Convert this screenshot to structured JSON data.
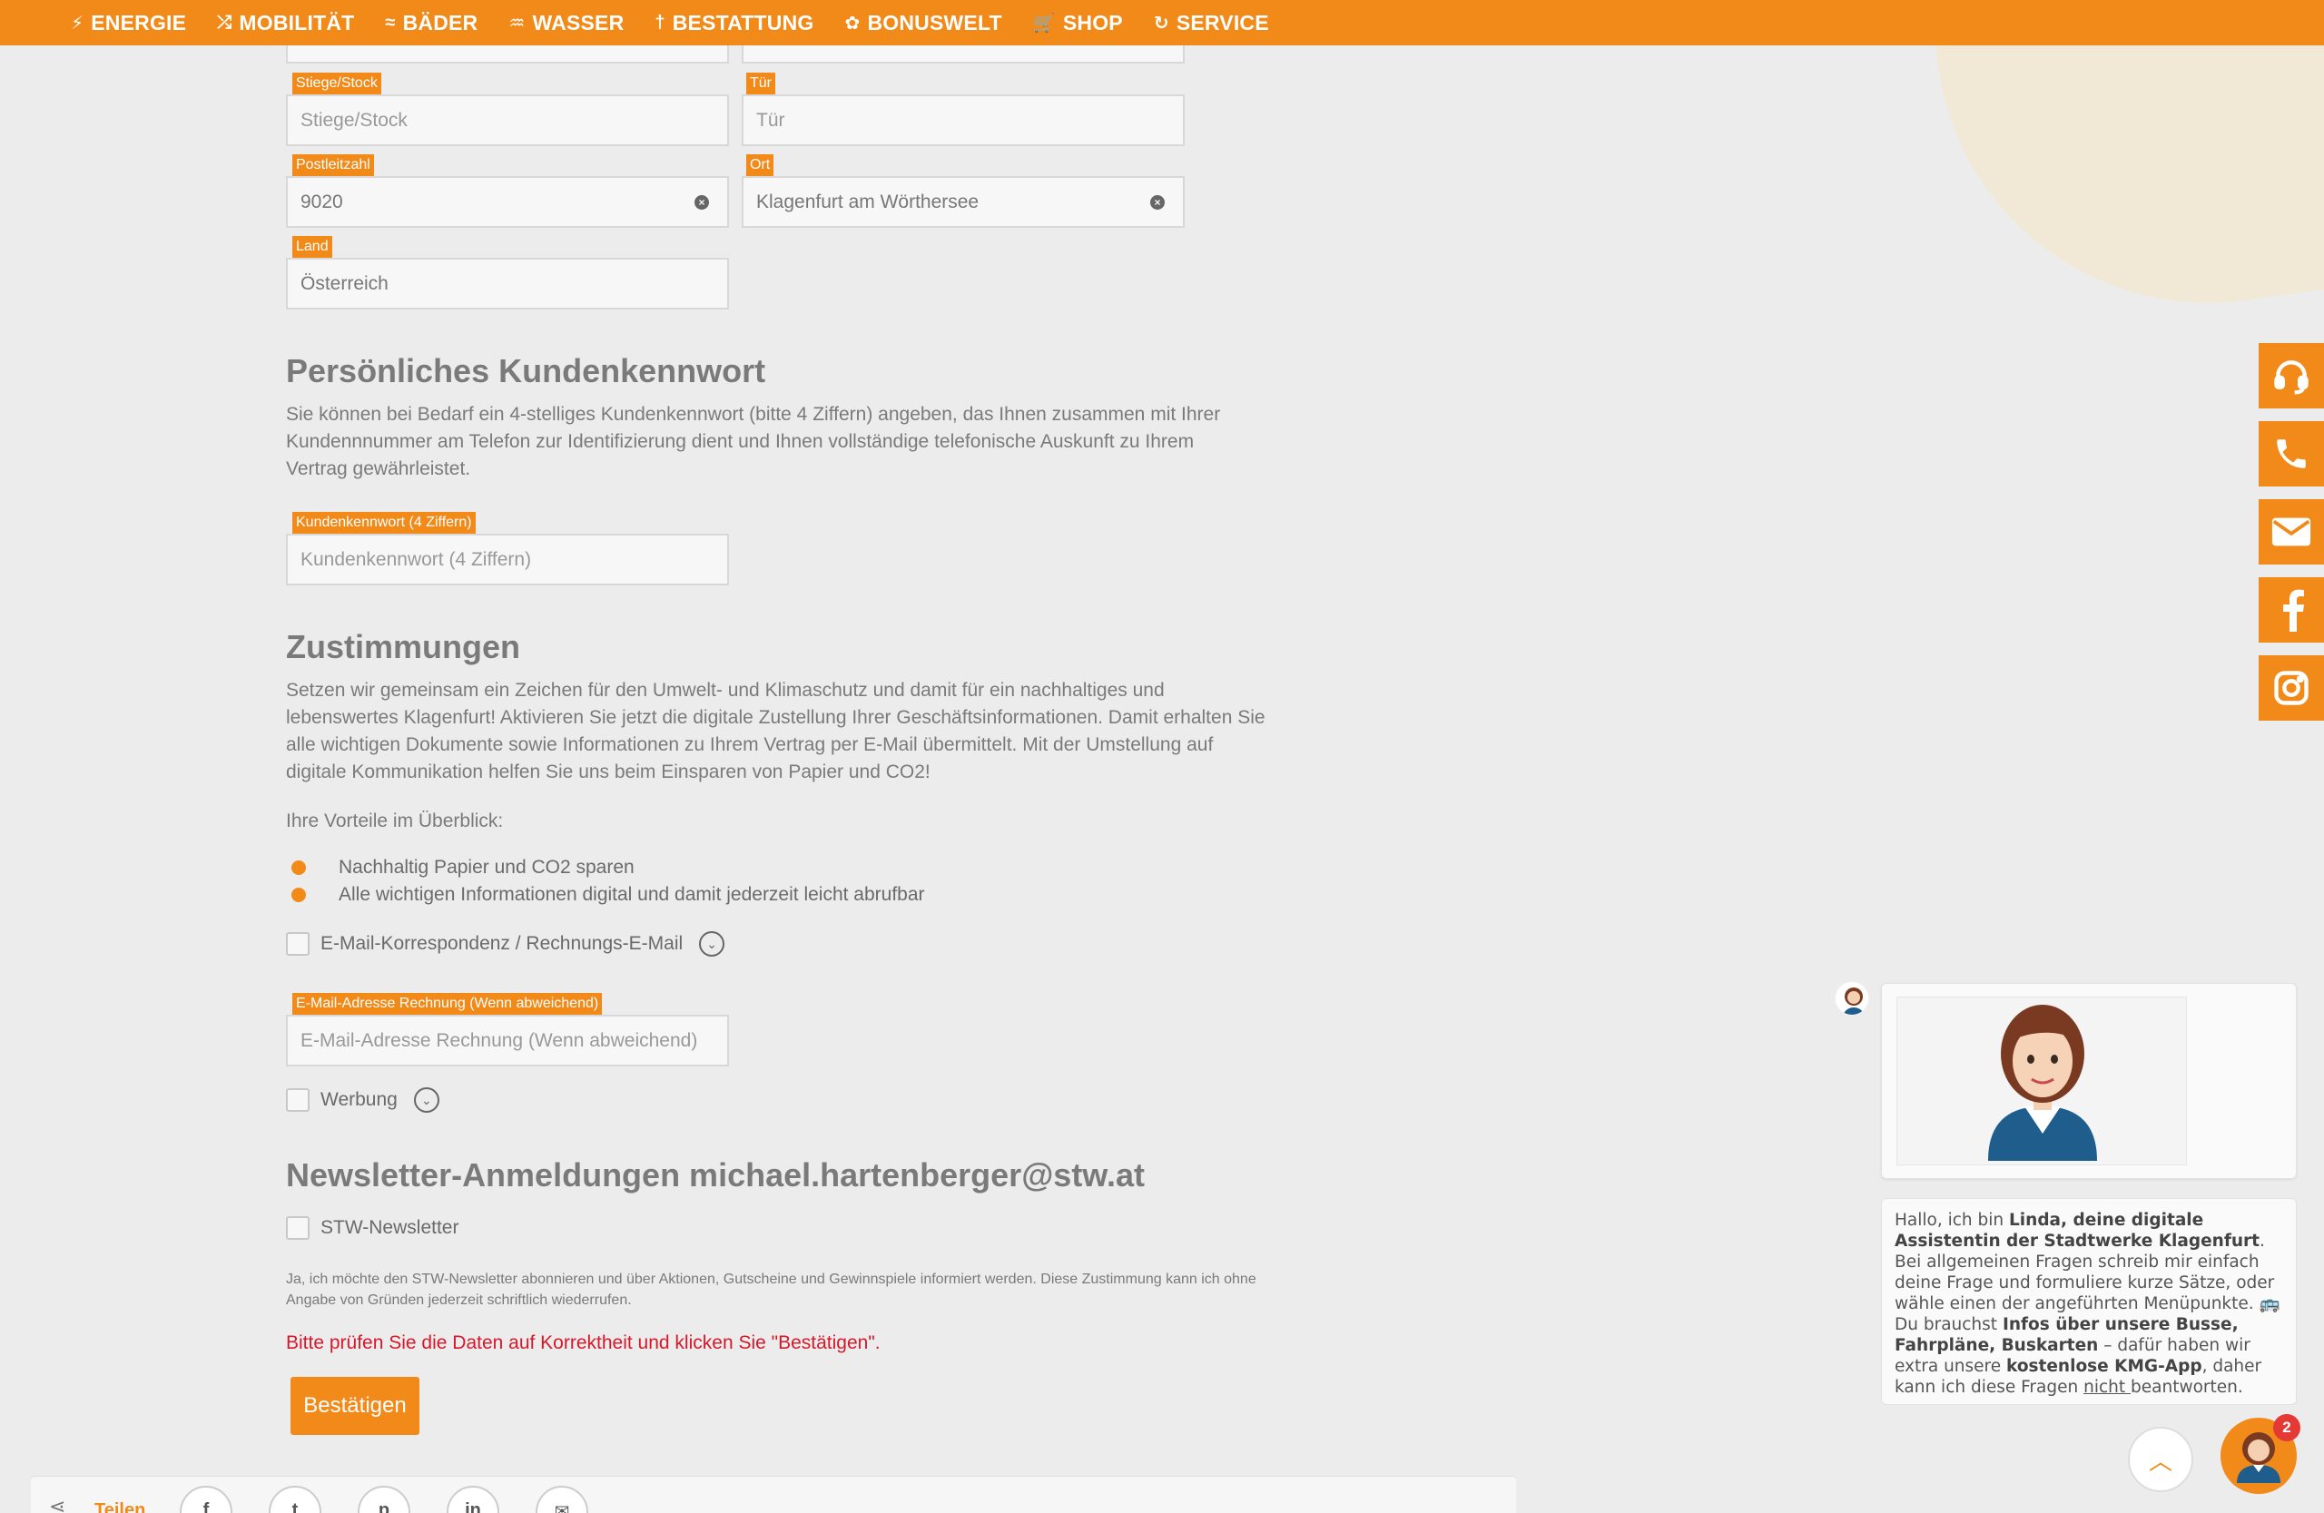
{
  "nav": {
    "items": [
      {
        "label": "ENERGIE",
        "icon": "⚡"
      },
      {
        "label": "MOBILITÄT",
        "icon": "⤮"
      },
      {
        "label": "BÄDER",
        "icon": "≈"
      },
      {
        "label": "WASSER",
        "icon": "♒"
      },
      {
        "label": "BESTATTUNG",
        "icon": "†"
      },
      {
        "label": "BONUSWELT",
        "icon": "✿"
      },
      {
        "label": "SHOP",
        "icon": "🛒"
      },
      {
        "label": "SERVICE",
        "icon": "↻"
      }
    ]
  },
  "address": {
    "stiege_label": "Stiege/Stock",
    "stiege_placeholder": "Stiege/Stock",
    "tuer_label": "Tür",
    "tuer_placeholder": "Tür",
    "plz_label": "Postleitzahl",
    "plz_value": "9020",
    "ort_label": "Ort",
    "ort_value": "Klagenfurt am Wörthersee",
    "land_label": "Land",
    "land_value": "Österreich"
  },
  "password": {
    "heading": "Persönliches Kundenkennwort",
    "text": "Sie können bei Bedarf ein 4-stelliges Kundenkennwort (bitte 4 Ziffern) angeben, das Ihnen zusammen mit Ihrer Kundennnummer am Telefon zur Identifizierung dient und Ihnen vollständige telefonische Auskunft zu Ihrem Vertrag gewährleistet.",
    "field_label": "Kundenkennwort (4 Ziffern)",
    "field_placeholder": "Kundenkennwort (4 Ziffern)"
  },
  "consent": {
    "heading": "Zustimmungen",
    "text": "Setzen wir gemeinsam ein Zeichen für den Umwelt- und Klimaschutz und damit für ein nachhaltiges und lebenswertes Klagenfurt! Aktivieren Sie jetzt die digitale Zustellung Ihrer Geschäftsinformationen. Damit erhalten Sie alle wichtigen Dokumente sowie Informationen zu Ihrem Vertrag per E-Mail übermittelt. Mit der Umstellung auf digitale Kommunikation helfen Sie uns beim Einsparen von Papier und CO2!",
    "advantages_intro": "Ihre Vorteile im Überblick:",
    "advantages": [
      "Nachhaltig Papier und CO2 sparen",
      "Alle wichtigen Informationen digital und damit jederzeit leicht abrufbar"
    ],
    "email_checkbox": "E-Mail-Korrespondenz / Rechnungs-E-Mail",
    "email_field_label": "E-Mail-Adresse Rechnung (Wenn abweichend)",
    "email_field_placeholder": "E-Mail-Adresse Rechnung (Wenn abweichend)",
    "ads_checkbox": "Werbung"
  },
  "newsletter": {
    "heading": "Newsletter-Anmeldungen michael.hartenberger@stw.at",
    "checkbox": "STW-Newsletter",
    "disclaimer": "Ja, ich möchte den STW-Newsletter abonnieren und über Aktionen, Gutscheine und Gewinnspiele informiert werden. Diese Zustimmung kann ich ohne Angabe von Gründen jederzeit schriftlich wiederrufen.",
    "error": "Bitte prüfen Sie die Daten auf Korrektheit und klicken Sie \"Bestätigen\".",
    "confirm": "Bestätigen"
  },
  "share": {
    "label": "Teilen",
    "buttons": [
      "f",
      "t",
      "p",
      "in",
      "✉"
    ]
  },
  "chat": {
    "badge": "2",
    "greeting_pre": "Hallo, ich bin ",
    "name": "Linda",
    "greeting_bold1": ", deine digitale Assistentin der Stadtwerke Klagenfurt",
    "text1": ". Bei allgemeinen Fragen schreib mir einfach deine Frage und formuliere kurze Sätze, oder wähle einen der angeführten Menüpunkte. 🚌 Du brauchst ",
    "bold2": "Infos über unsere Busse, Fahrpläne, Buskarten",
    "text2": " – dafür haben wir extra unsere ",
    "bold3": "kostenlose KMG-App",
    "text3": ", daher kann ich diese Fragen ",
    "underline": "nicht ",
    "text4": "beantworten."
  },
  "colors": {
    "accent": "#f28a1a",
    "error": "#d8182a"
  }
}
